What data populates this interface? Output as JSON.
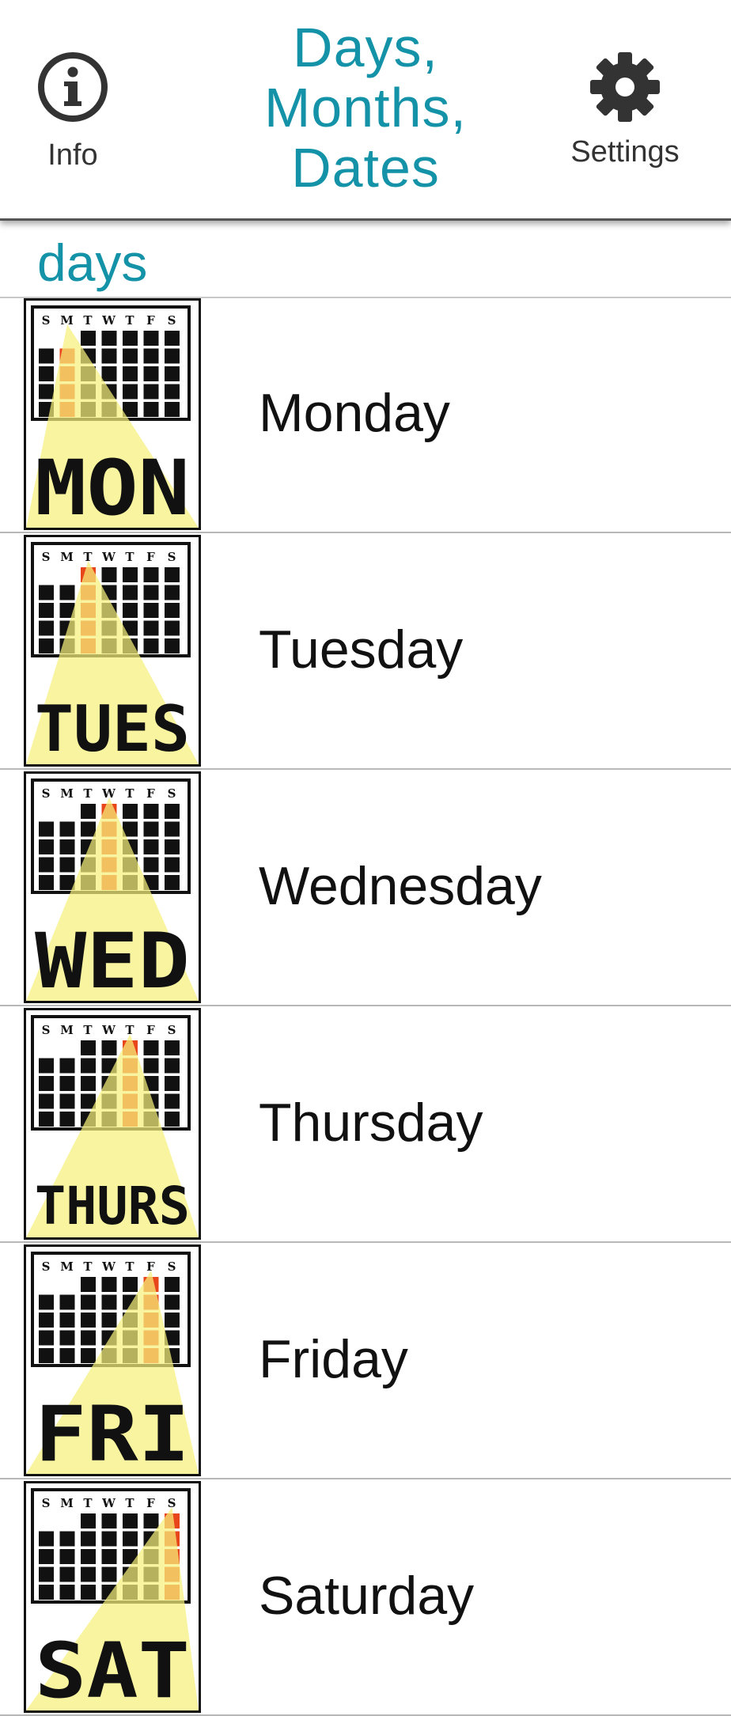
{
  "header": {
    "info_label": "Info",
    "settings_label": "Settings",
    "title_lines": [
      "Days,",
      "Months,",
      "Dates"
    ]
  },
  "colors": {
    "accent": "#1493a8",
    "highlight": "#e8461a",
    "beam": "#f5f07a"
  },
  "section": {
    "title": "days"
  },
  "day_letters": "SMTWTFS",
  "days": [
    {
      "label": "Monday",
      "abbr": "MON",
      "col": 1
    },
    {
      "label": "Tuesday",
      "abbr": "TUES",
      "col": 2
    },
    {
      "label": "Wednesday",
      "abbr": "WED",
      "col": 3
    },
    {
      "label": "Thursday",
      "abbr": "THURS",
      "col": 4
    },
    {
      "label": "Friday",
      "abbr": "FRI",
      "col": 5
    },
    {
      "label": "Saturday",
      "abbr": "SAT",
      "col": 6
    }
  ]
}
